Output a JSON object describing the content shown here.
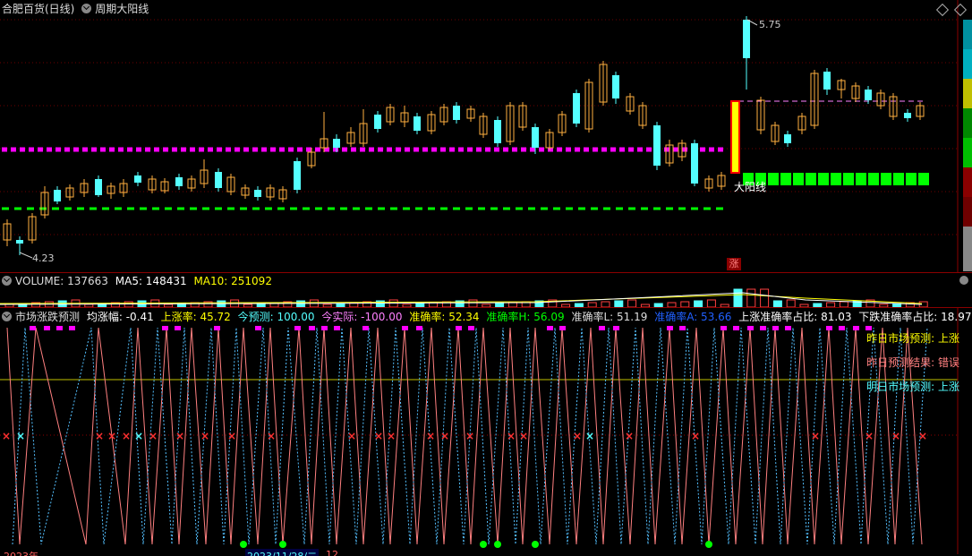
{
  "main": {
    "stock_name": "合肥百货(日线)",
    "indicator_name": "周期大阳线",
    "price_high_label": "5.75",
    "price_low_label": "4.23",
    "big_yang_label": "大阳线",
    "zhang_label": "涨"
  },
  "volume": {
    "label": "VOLUME: 137663",
    "ma5": "MA5: 148431",
    "ma10": "MA10: 251092"
  },
  "indicator": {
    "name": "市场涨跌预测",
    "avg_change": "均涨幅: -0.41",
    "rise_rate": "上涨率: 45.72",
    "today_forecast": "今预测: 100.00",
    "today_actual": "今实际: -100.00",
    "accuracy": "准确率: 52.34",
    "accuracy_h": "准确率H: 56.09",
    "accuracy_l": "准确率L: 51.19",
    "accuracy_a": "准确率A: 53.66",
    "rise_accuracy_ratio": "上涨准确率占比: 81.03",
    "fall_accuracy_ratio": "下跌准确率占比: 18.97",
    "legend_yesterday_forecast": "昨日市场预测: 上涨",
    "legend_yesterday_result": "昨日预测结果: 错误",
    "legend_tomorrow_forecast": "明日市场预测: 上涨"
  },
  "footer": {
    "date_label": "2023/11/28/二",
    "left_label": "2023年",
    "mid_label": "12"
  },
  "colors": {
    "up": "#ff4040",
    "down": "#54ffff",
    "yang": "#ffff00",
    "magenta": "#ff00ff",
    "green": "#00ff00"
  }
}
